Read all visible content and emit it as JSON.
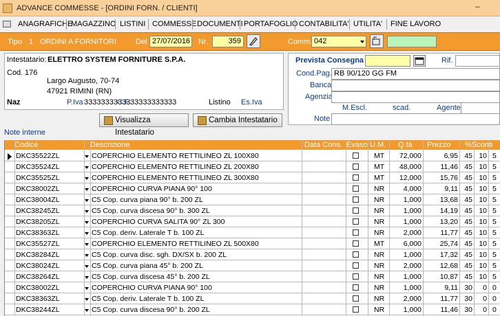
{
  "window": {
    "title": "ADVANCE COMMESSE - [ORDINI FORN. / CLIENTI]",
    "minimize": "–"
  },
  "menu": [
    "ANAGRAFICHE",
    "MAGAZZINO",
    "LISTINI",
    "COMMESSE",
    "DOCUMENTI",
    "PORTAFOGLIO",
    "CONTABILITA'",
    "UTILITA'",
    "FINE LAVORO"
  ],
  "header": {
    "tipo_label": "Tipo",
    "tipo_value": "1",
    "tipo_desc": "ORDINI A FORNITORI",
    "del_label": "Del",
    "del_value": "27/07/2016",
    "nr_label": "Nr.",
    "nr_value": "359",
    "comm_label": "Comm.",
    "comm_value": "042"
  },
  "intestatario": {
    "label": "Intestatario:",
    "name": "ELETTRO SYSTEM FORNITURE S.P.A.",
    "cod_label": "Cod.",
    "cod_value": "176",
    "address": "Largo Augusto, 70-74",
    "city": "47921 RIMINI (RN)",
    "naz_label": "Naz",
    "piva_label": "P.Iva",
    "piva_value": "33333333333",
    "cf_label": "C.F.",
    "cf_value": "33333333333",
    "listino_label": "Listino",
    "listino_value": "Es.Iva"
  },
  "right_panel": {
    "prevista_label": "Prevista Consegna",
    "prevista_value": "",
    "rif_label": "Rif.",
    "condpag_label": "Cond.Pag.",
    "condpag_value": "RB 90/120 GG FM",
    "banca_label": "Banca",
    "agenzia_label": "Agenzia",
    "mescl_label": "M.Escl.",
    "scad_label": "scad.",
    "agente_label": "Agente",
    "note_label": "Note"
  },
  "buttons": {
    "visualizza": "Visualizza Intestatario",
    "cambia": "Cambia Intestatario"
  },
  "note_interne": "Note interne",
  "columns": {
    "codice": "Codice",
    "descrizione": "Descrizione",
    "data_cons": "Data Cons.",
    "evaso": "Evaso",
    "um": "U.M.",
    "qta": "Q.tà",
    "prezzo": "Prezzo",
    "sconti": "%Sconti"
  },
  "rows": [
    {
      "codice": "DKC35522ZL",
      "descrizione": "COPERCHIO ELEMENTO RETTILINEO ZL 100X80",
      "um": "MT",
      "qta": "72,000",
      "prezzo": "6,95",
      "s1": "45",
      "s2": "10",
      "s3": "5"
    },
    {
      "codice": "DKC35524ZL",
      "descrizione": "COPERCHIO ELEMENTO RETTILINEO ZL 200X80",
      "um": "MT",
      "qta": "48,000",
      "prezzo": "11,46",
      "s1": "45",
      "s2": "10",
      "s3": "5"
    },
    {
      "codice": "DKC35525ZL",
      "descrizione": "COPERCHIO ELEMENTO RETTILINEO ZL 300X80",
      "um": "MT",
      "qta": "12,000",
      "prezzo": "15,76",
      "s1": "45",
      "s2": "10",
      "s3": "5"
    },
    {
      "codice": "DKC38002ZL",
      "descrizione": "COPERCHIO CURVA PIANA 90° 100",
      "um": "NR",
      "qta": "4,000",
      "prezzo": "9,11",
      "s1": "45",
      "s2": "10",
      "s3": "5"
    },
    {
      "codice": "DKC38004ZL",
      "descrizione": "C5 Cop. curva piana  90°   b. 200  ZL",
      "um": "NR",
      "qta": "1,000",
      "prezzo": "13,68",
      "s1": "45",
      "s2": "10",
      "s3": "5"
    },
    {
      "codice": "DKC38245ZL",
      "descrizione": "C5 Cop. curva discesa  90°   b. 300  ZL",
      "um": "NR",
      "qta": "1,000",
      "prezzo": "14,19",
      "s1": "45",
      "s2": "10",
      "s3": "5"
    },
    {
      "codice": "DKC38205ZL",
      "descrizione": "COPERCHIO CURVA SALITA 90° ZL  300",
      "um": "NR",
      "qta": "1,000",
      "prezzo": "13,20",
      "s1": "45",
      "s2": "10",
      "s3": "5"
    },
    {
      "codice": "DKC38363ZL",
      "descrizione": "C5 Cop. deriv. Laterale  T   b. 100  ZL",
      "um": "NR",
      "qta": "2,000",
      "prezzo": "11,77",
      "s1": "45",
      "s2": "10",
      "s3": "5"
    },
    {
      "codice": "DKC35527ZL",
      "descrizione": "COPERCHIO ELEMENTO RETTILINEO ZL 500X80",
      "um": "MT",
      "qta": "6,000",
      "prezzo": "25,74",
      "s1": "45",
      "s2": "10",
      "s3": "5"
    },
    {
      "codice": "DKC38284ZL",
      "descrizione": "C5 Cop. curva disc. sgh. DX/SX   b. 200  ZL",
      "um": "NR",
      "qta": "1,000",
      "prezzo": "17,32",
      "s1": "45",
      "s2": "10",
      "s3": "5"
    },
    {
      "codice": "DKC38024ZL",
      "descrizione": "C5 Cop. curva piana  45°   b. 200  ZL",
      "um": "NR",
      "qta": "2,000",
      "prezzo": "12,68",
      "s1": "45",
      "s2": "10",
      "s3": "5"
    },
    {
      "codice": "DKC38264ZL",
      "descrizione": "C5 Cop. curva discesa  45°   b. 200  ZL",
      "um": "NR",
      "qta": "1,000",
      "prezzo": "10,87",
      "s1": "45",
      "s2": "10",
      "s3": "5"
    },
    {
      "codice": "DKC38002ZL",
      "descrizione": "COPERCHIO CURVA PIANA 90° 100",
      "um": "NR",
      "qta": "1,000",
      "prezzo": "9,11",
      "s1": "30",
      "s2": "0",
      "s3": "0"
    },
    {
      "codice": "DKC38363ZL",
      "descrizione": "C5 Cop. deriv. Laterale  T   b. 100  ZL",
      "um": "NR",
      "qta": "2,000",
      "prezzo": "11,77",
      "s1": "30",
      "s2": "0",
      "s3": "0"
    },
    {
      "codice": "DKC38244ZL",
      "descrizione": "C5 Cop. curva discesa  90°   b. 200  ZL",
      "um": "NR",
      "qta": "1,000",
      "prezzo": "11,46",
      "s1": "30",
      "s2": "0",
      "s3": "0"
    }
  ],
  "colors": {
    "orange": "#f29a2e",
    "yellow_field": "#ffffa8",
    "green_field": "#b9f5b9",
    "title_bg": "#f7d09a"
  }
}
